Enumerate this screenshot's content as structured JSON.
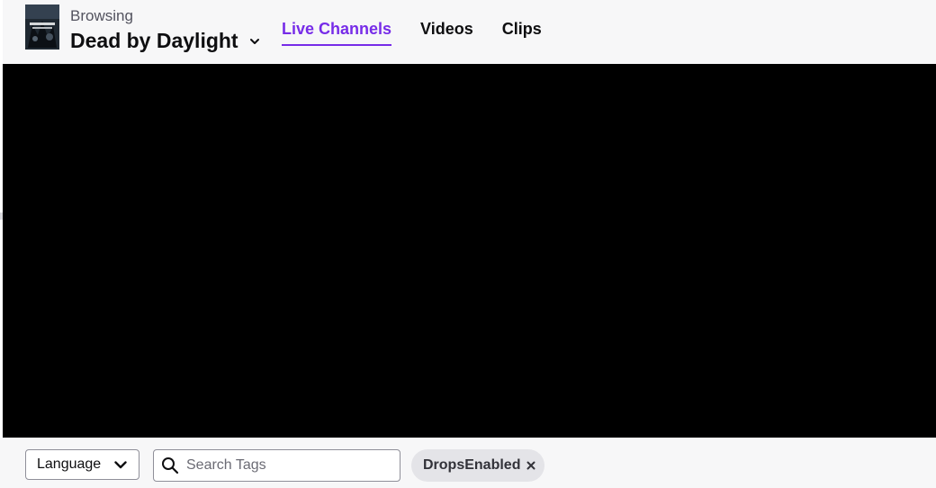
{
  "header": {
    "browsing_label": "Browsing",
    "game_title": "Dead by Daylight",
    "game_thumbnail_icon": "game-box-art-icon",
    "selector_icon": "chevron-down-icon"
  },
  "nav": {
    "tabs": [
      {
        "label": "Live Channels",
        "active": true
      },
      {
        "label": "Videos",
        "active": false
      },
      {
        "label": "Clips",
        "active": false
      }
    ]
  },
  "filters": {
    "language": {
      "label": "Language",
      "icon": "chevron-down-icon"
    },
    "search": {
      "placeholder": "Search Tags",
      "value": "",
      "icon": "search-icon"
    },
    "active_tags": [
      {
        "label": "DropsEnabled",
        "remove_icon": "close-icon"
      }
    ]
  },
  "colors": {
    "accent": "#772ce8",
    "background": "#f7f7f8",
    "text": "#0e0e10",
    "muted_text": "#53535f",
    "video_background": "#000000",
    "tag_background": "#e4e4e8"
  }
}
